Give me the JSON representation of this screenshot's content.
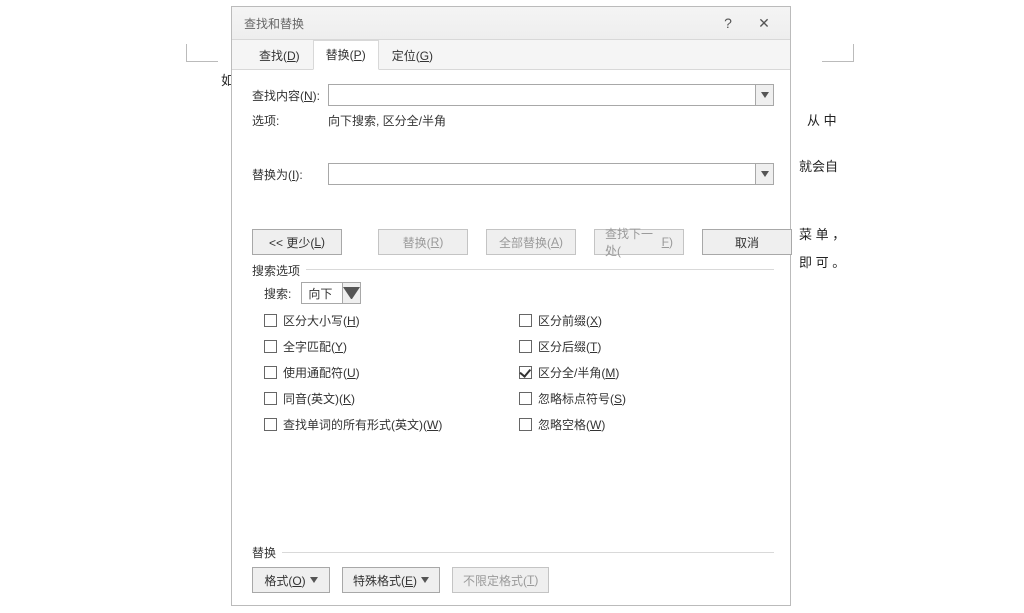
{
  "dialog": {
    "title": "查找和替换",
    "help_label": "?",
    "close_label": "✕",
    "tabs": {
      "find": "查找(D)",
      "replace": "替换(P)",
      "goto": "定位(G)"
    },
    "find_label": "查找内容(N):",
    "options_label": "选项:",
    "options_value": "向下搜索, 区分全/半角",
    "replace_label": "替换为(I):",
    "btn_less": "<< 更少(L)",
    "btn_replace": "替换(R)",
    "btn_replace_all": "全部替换(A)",
    "btn_find_next": "查找下一处(F)",
    "btn_cancel": "取消"
  },
  "search_options": {
    "legend": "搜索选项",
    "search_label": "搜索:",
    "direction": "向下",
    "left": {
      "match_case": "区分大小写(H)",
      "whole_word": "全字匹配(Y)",
      "wildcards": "使用通配符(U)",
      "sounds_like": "同音(英文)(K)",
      "all_forms": "查找单词的所有形式(英文)(W)"
    },
    "right": {
      "prefix": "区分前缀(X)",
      "suffix": "区分后缀(T)",
      "full_half": "区分全/半角(M)",
      "ignore_punct": "忽略标点符号(S)",
      "ignore_space": "忽略空格(W)"
    }
  },
  "replace_section": {
    "legend": "替换",
    "format": "格式(O)",
    "special": "特殊格式(E)",
    "no_format": "不限定格式(T)"
  },
  "background_text": {
    "r1": "从 中",
    "r2": "就会自",
    "r3": "菜 单 ，",
    "r4": "即 可 。"
  }
}
